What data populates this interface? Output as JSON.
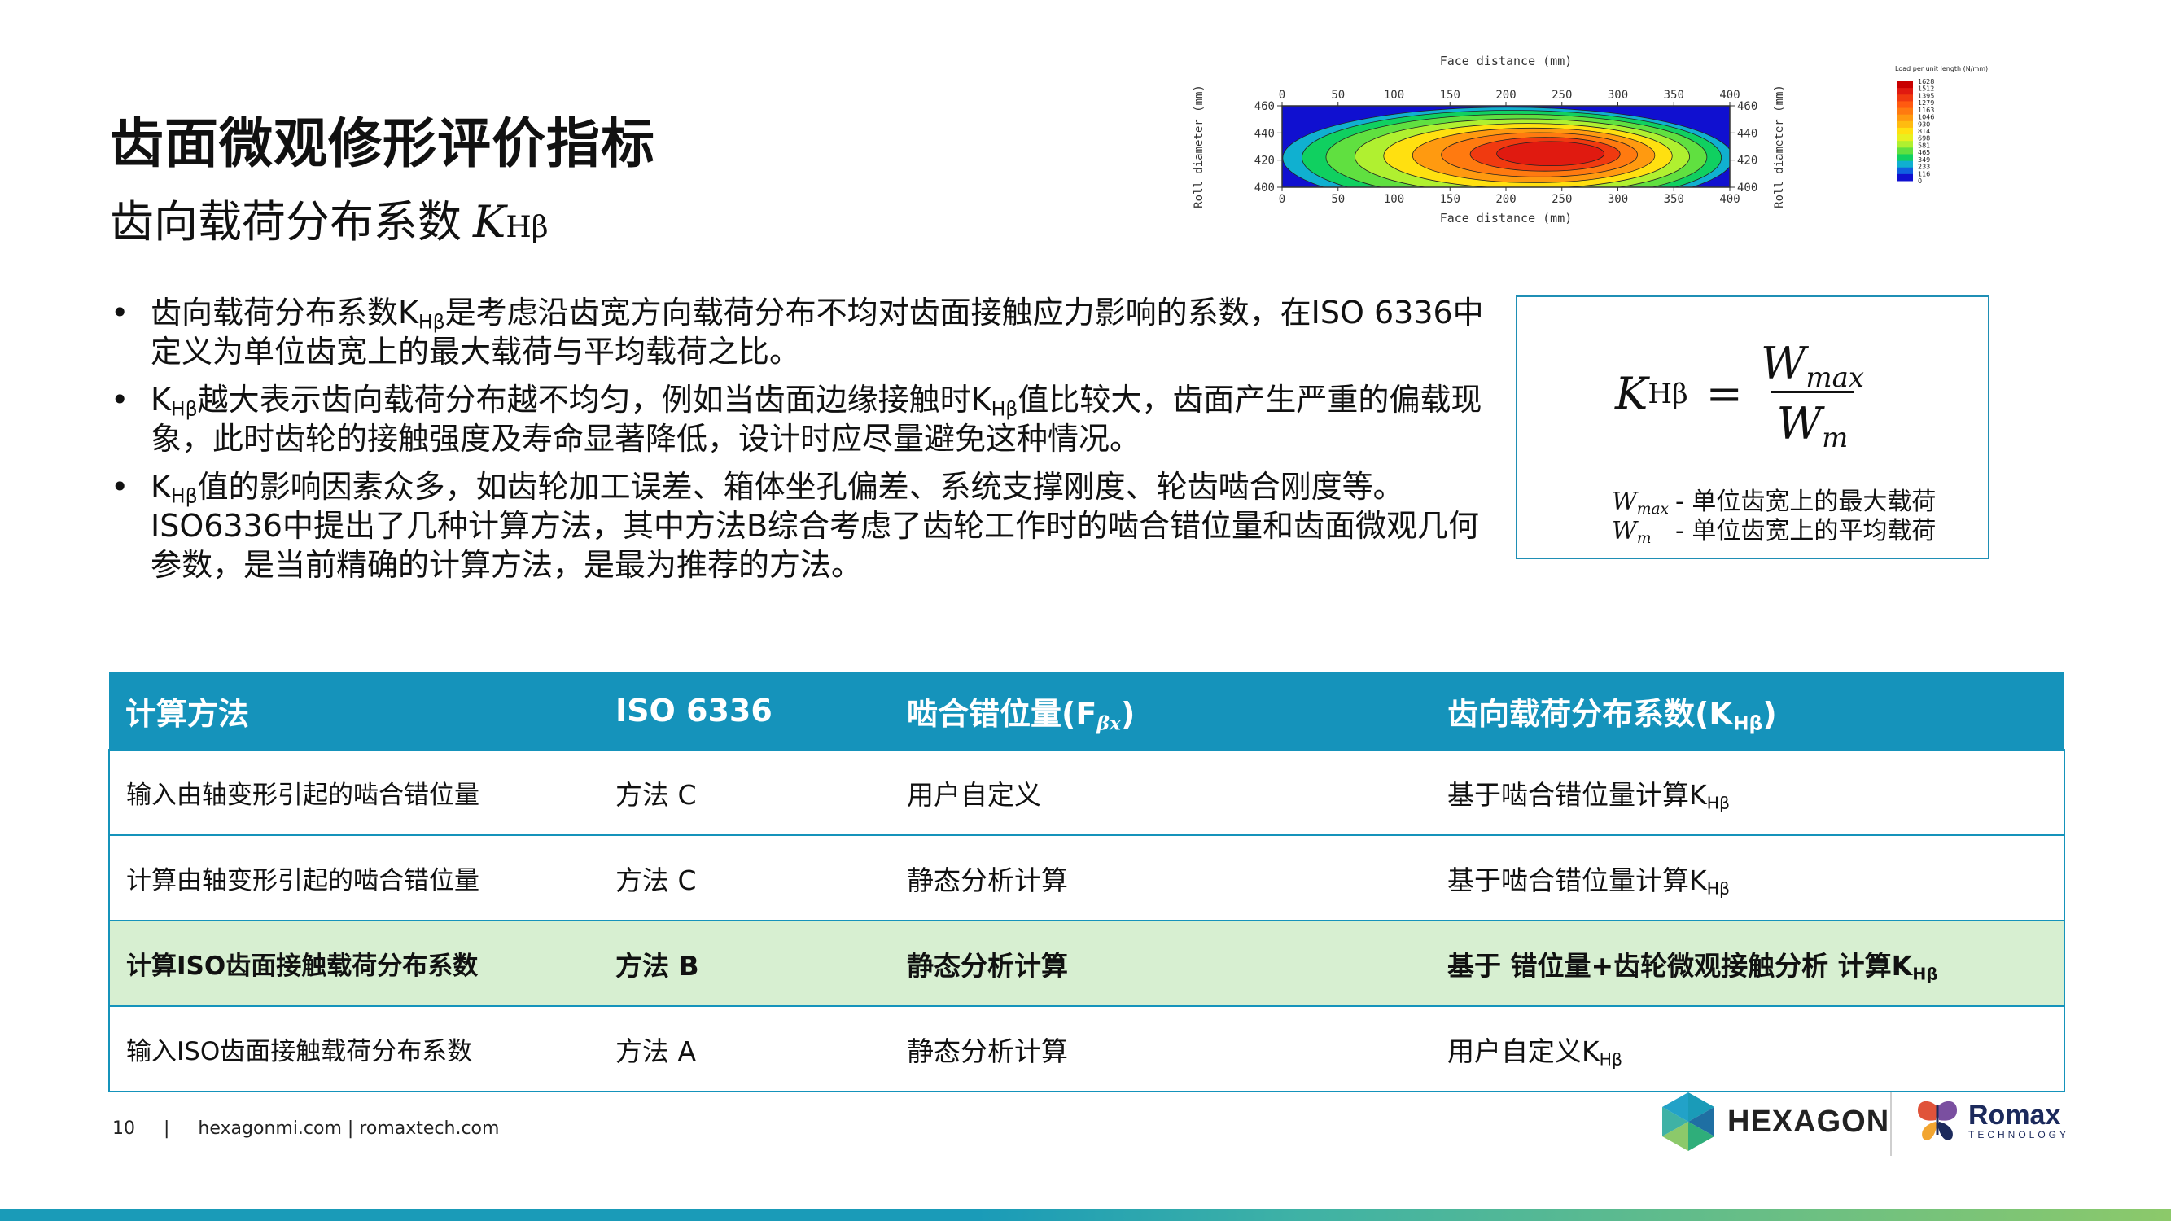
{
  "slide": {
    "title": "齿面微观修形评价指标",
    "subtitle": "齿向载荷分布系数",
    "k_symbol": "K",
    "k_sub": "Hβ"
  },
  "bullets": [
    {
      "p1": "齿向载荷分布系数K",
      "sub1": "Hβ",
      "p2": "是考虑沿齿宽方向载荷分布不均对齿面接触应力影响的系数，在ISO 6336中定义为单位齿宽上的最大载荷与平均载荷之比。"
    },
    {
      "p1": "K",
      "sub1": "Hβ",
      "p2": "越大表示齿向载荷分布越不均匀，例如当齿面边缘接触时K",
      "sub2": "Hβ",
      "p3": "值比较大，齿面产生严重的偏载现象，此时齿轮的接触强度及寿命显著降低，设计时应尽量避免这种情况。"
    },
    {
      "p1": "K",
      "sub1": "Hβ",
      "p2": "值的影响因素众多，如齿轮加工误差、箱体坐孔偏差、系统支撑刚度、轮齿啮合刚度等。ISO6336中提出了几种计算方法，其中方法B综合考虑了齿轮工作时的啮合错位量和齿面微观几何参数，是当前精确的计算方法，是最为推荐的方法。"
    }
  ],
  "formula": {
    "lhs_k": "K",
    "lhs_sub": "Hβ",
    "equals": "=",
    "num_w": "W",
    "num_sub": "max",
    "den_w": "W",
    "den_sub": "m",
    "legend_max_sym": "W",
    "legend_max_sub": "max",
    "legend_max_text": "- 单位齿宽上的最大载荷",
    "legend_m_sym": "W",
    "legend_m_sub": "m",
    "legend_m_text": "- 单位齿宽上的平均载荷"
  },
  "table": {
    "headers": {
      "col1": "计算方法",
      "col2": "ISO 6336",
      "col3": "啮合错位量(F",
      "col3_sub": "βx",
      "col3_end": ")",
      "col4": "齿向载荷分布系数(K",
      "col4_sub": "Hβ",
      "col4_end": ")"
    },
    "rows": [
      {
        "method": "输入由轴变形引起的啮合错位量",
        "iso": "方法 C",
        "misalign": "用户自定义",
        "khb": "基于啮合错位量计算K",
        "khb_sub": "Hβ"
      },
      {
        "method": "计算由轴变形引起的啮合错位量",
        "iso": "方法 C",
        "misalign": "静态分析计算",
        "khb": "基于啮合错位量计算K",
        "khb_sub": "Hβ"
      },
      {
        "method": "计算ISO齿面接触载荷分布系数",
        "iso": "方法 B",
        "misalign": "静态分析计算",
        "khb": "基于 错位量+齿轮微观接触分析 计算K",
        "khb_sub": "Hβ"
      },
      {
        "method": "输入ISO齿面接触载荷分布系数",
        "iso": "方法 A",
        "misalign": "静态分析计算",
        "khb": "用户自定义K",
        "khb_sub": "Hβ"
      }
    ]
  },
  "footer": {
    "page_number": "10",
    "separator": "|",
    "links": "hexagonmi.com | romaxtech.com"
  },
  "logos": {
    "hexagon": "HEXAGON",
    "romax": "Romax",
    "romax_tagline": "TECHNOLOGY"
  },
  "chart_data": {
    "type": "heatmap",
    "xlabel": "Face distance (mm)",
    "ylabel": "Roll diameter (mm)",
    "x_ticks": [
      "0",
      "50",
      "100",
      "150",
      "200",
      "250",
      "300",
      "350",
      "400"
    ],
    "y_ticks": [
      "460",
      "440",
      "420",
      "400"
    ],
    "xlim": [
      0,
      400
    ],
    "ylim": [
      400,
      460
    ],
    "colorbar_title": "Load per unit length (N/mm)",
    "colorbar_levels": [
      "1628",
      "1512",
      "1395",
      "1279",
      "1163",
      "1046",
      "930",
      "814",
      "698",
      "581",
      "465",
      "349",
      "233",
      "116",
      "0"
    ],
    "colorbar_colors": [
      "#c80000",
      "#e01a10",
      "#f03a10",
      "#ff5a10",
      "#ff7a10",
      "#ff9a10",
      "#ffbb10",
      "#ffe010",
      "#e8f020",
      "#b0f030",
      "#60e040",
      "#10d060",
      "#10b0d0",
      "#1060e0",
      "#1010d0"
    ],
    "contour_levels": [
      0.04,
      0.12,
      0.22,
      0.34,
      0.46,
      0.58,
      0.7,
      0.82,
      0.93
    ],
    "peak": {
      "x": 250,
      "y": 425
    },
    "grid": false
  },
  "colors": {
    "accent": "#1593bb",
    "highlight_row": "#d7efd1",
    "formula_border": "#1f8fb5"
  }
}
